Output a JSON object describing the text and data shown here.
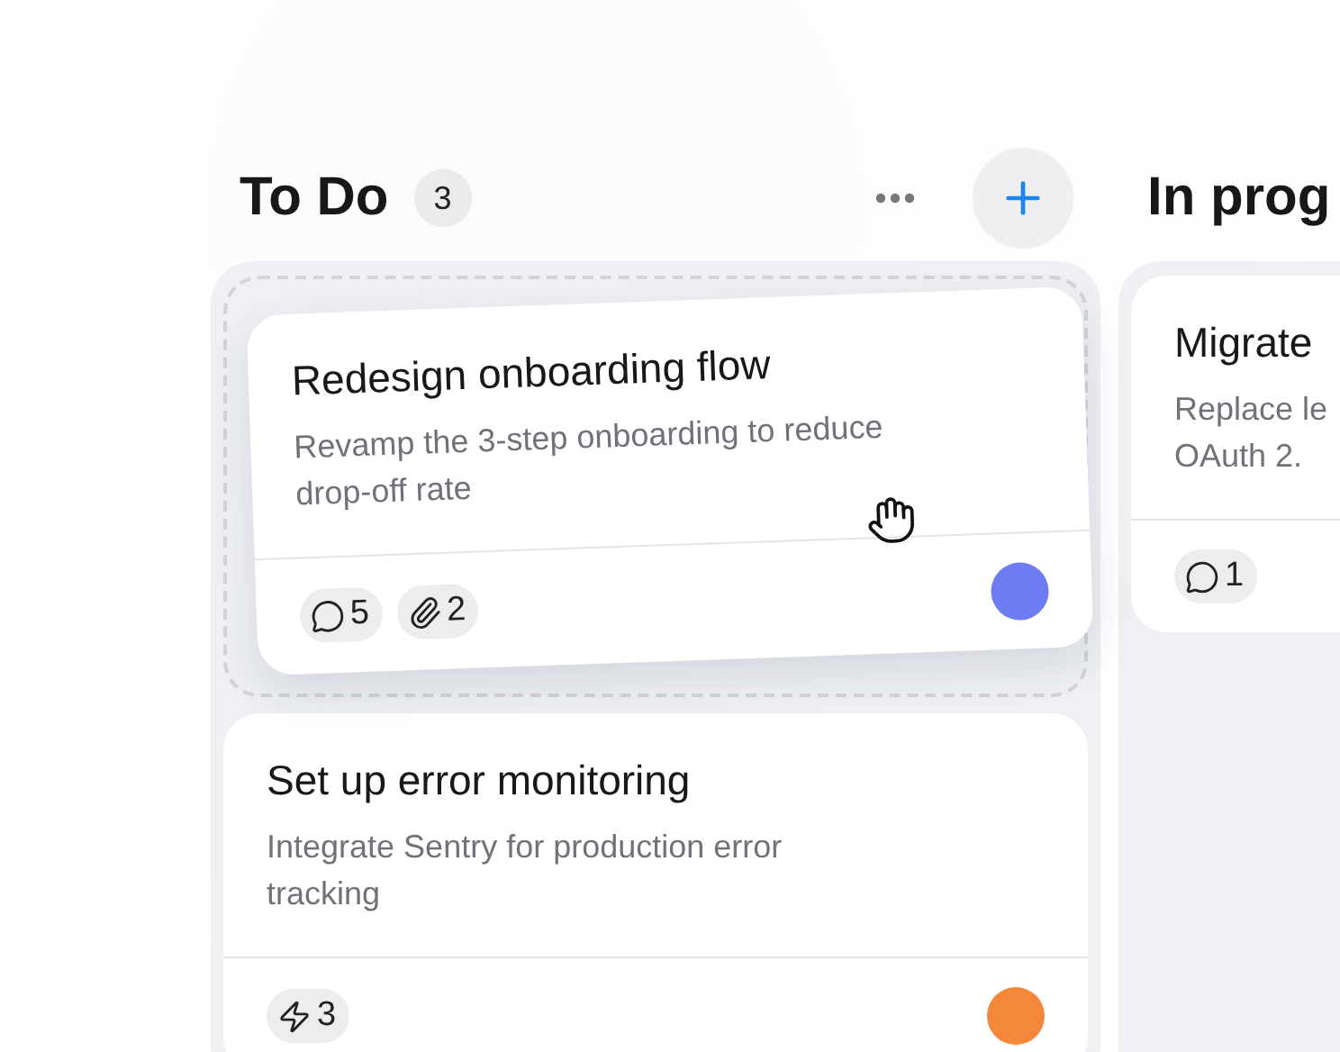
{
  "columns": [
    {
      "title": "To Do",
      "count": "3",
      "cards": [
        {
          "title": "Redesign onboarding flow",
          "description": "Revamp the 3-step onboarding to reduce\ndrop-off rate",
          "dragging": true,
          "chips": [
            {
              "kind": "comments",
              "count": "5"
            },
            {
              "kind": "attachments",
              "count": "2"
            }
          ],
          "color": "#6d7cf0"
        },
        {
          "title": "Set up error monitoring",
          "description": "Integrate Sentry for production error\ntracking",
          "dragging": false,
          "chips": [
            {
              "kind": "activity",
              "count": "3"
            }
          ],
          "color": "#f3883a"
        }
      ]
    },
    {
      "title": "In prog",
      "cards": [
        {
          "title": "Migrate",
          "description": "Replace le\nOAuth 2.",
          "dragging": false,
          "chips": [
            {
              "kind": "comments",
              "count": "1"
            }
          ]
        }
      ]
    }
  ]
}
